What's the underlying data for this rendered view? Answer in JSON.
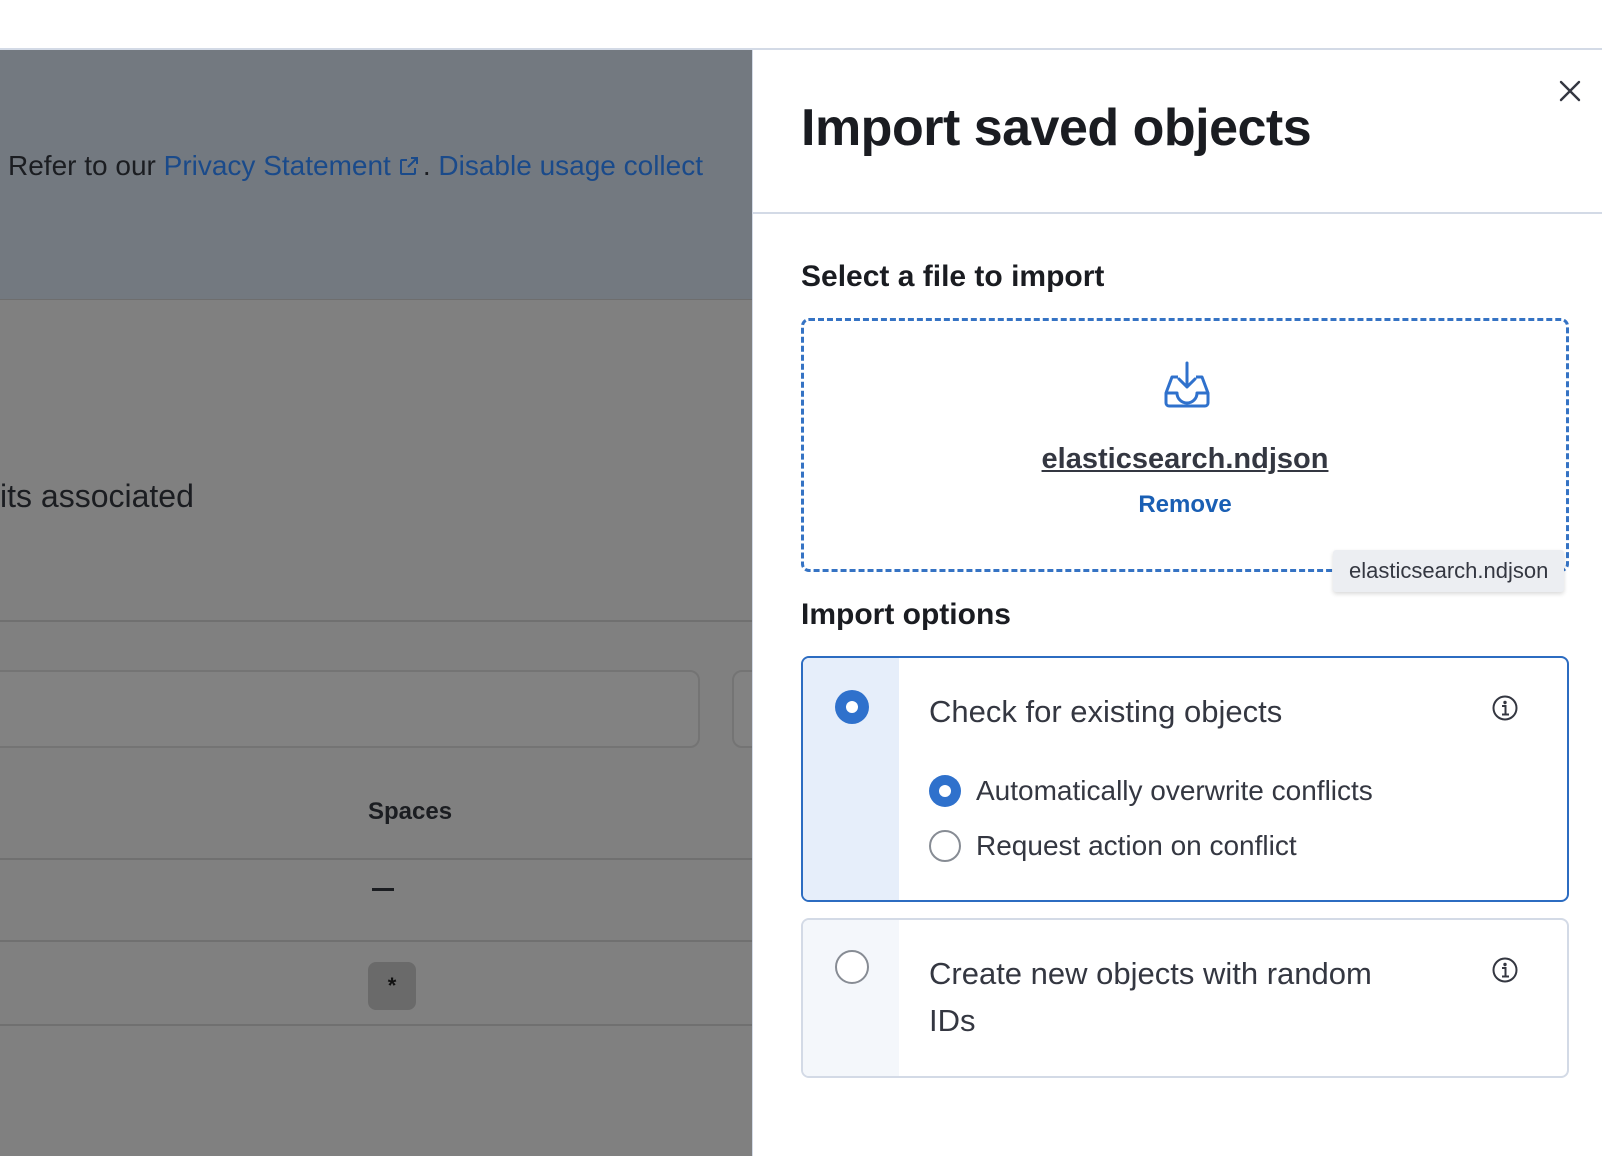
{
  "background": {
    "privacy_prefix": "Refer to our ",
    "privacy_link": "Privacy Statement",
    "privacy_sep": ". ",
    "disable_link": "Disable usage collect",
    "assoc_text": "its associated",
    "spaces_header": "Spaces",
    "row2_badge": "*"
  },
  "flyout": {
    "title": "Import saved objects",
    "file_section_label": "Select a file to import",
    "file_name": "elasticsearch.ndjson",
    "remove_label": "Remove",
    "tooltip": "elasticsearch.ndjson",
    "options_label": "Import options",
    "option_check": {
      "title": "Check for existing objects",
      "selected": true,
      "sub_options": [
        {
          "label": "Automatically overwrite conflicts",
          "selected": true
        },
        {
          "label": "Request action on conflict",
          "selected": false
        }
      ]
    },
    "option_create": {
      "title_line1": "Create new objects with random",
      "title_line2": "IDs",
      "selected": false
    }
  },
  "colors": {
    "accent": "#2f71cc",
    "link": "#1a5fb4",
    "overlay": "#808080"
  },
  "icons": [
    "external-link-icon",
    "close-icon",
    "import-icon",
    "info-icon"
  ]
}
